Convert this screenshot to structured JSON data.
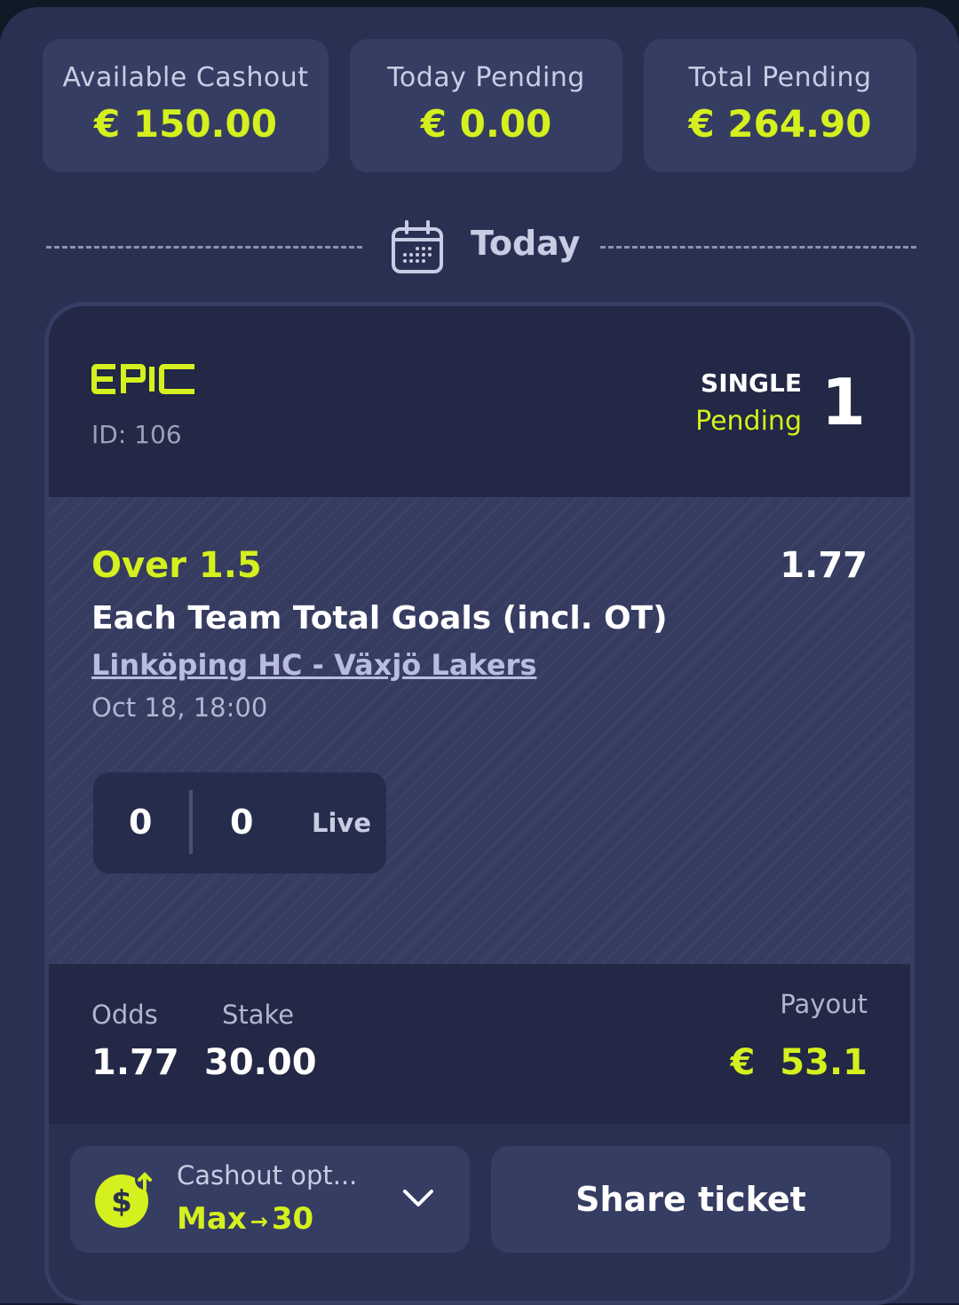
{
  "stats": [
    {
      "label": "Available Cashout",
      "value": "€ 150.00"
    },
    {
      "label": "Today Pending",
      "value": "€ 0.00"
    },
    {
      "label": "Total Pending",
      "value": "€ 264.90"
    }
  ],
  "section": {
    "title": "Today"
  },
  "ticket": {
    "brand": "EPIC",
    "id": "ID: 106",
    "type": "SINGLE",
    "status": "Pending",
    "selection_count": "1",
    "selection": {
      "market_value": "Over 1.5",
      "odds": "1.77",
      "market_name": "Each Team Total Goals (incl. OT)",
      "match": "Linköping HC - Växjö Lakers",
      "datetime": "Oct 18, 18:00",
      "score_home": "0",
      "score_away": "0",
      "live_label": "Live"
    },
    "summary": {
      "odds_label": "Odds",
      "odds_value": "1.77",
      "stake_label": "Stake",
      "stake_value": "30.00",
      "payout_label": "Payout",
      "payout_currency": "€",
      "payout_value": "53.1"
    },
    "actions": {
      "cashout_label": "Cashout opt...",
      "cashout_value": "Max",
      "cashout_arrow": "→",
      "cashout_amount": "30",
      "share_label": "Share ticket"
    }
  },
  "colors": {
    "accent": "#d4f01e",
    "panel": "#2a3051",
    "card": "#22284a"
  }
}
